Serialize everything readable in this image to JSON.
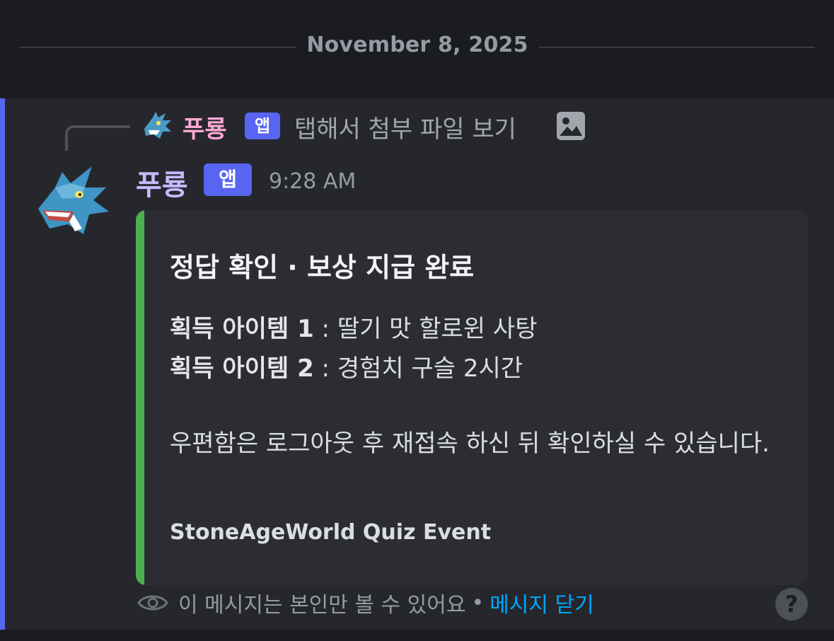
{
  "date_divider": {
    "label": "November 8, 2025"
  },
  "reply_preview": {
    "author": "푸룡",
    "tag": "앱",
    "text": "탭해서 첨부 파일 보기",
    "attachment_icon": "image-icon",
    "author_color": "#f9a8d4"
  },
  "message": {
    "author": "푸룡",
    "tag": "앱",
    "timestamp": "9:28 AM",
    "author_color": "#c9b8ff",
    "mention_highlight_color": "#5865f2"
  },
  "embed": {
    "accent_color": "#4caf50",
    "title": "정답 확인 · 보상 지급 완료",
    "items": [
      {
        "label": "획득 아이템 1",
        "separator": " : ",
        "value": "딸기 맛 할로윈 사탕"
      },
      {
        "label": "획득 아이템 2",
        "separator": " : ",
        "value": "경험치 구슬 2시간"
      }
    ],
    "notice": "우편함은 로그아웃 후 재접속 하신 뒤 확인하실 수 있습니다.",
    "footer": "StoneAgeWorld Quiz Event"
  },
  "ephemeral": {
    "icon": "eye-icon",
    "text": "이 메시지는 본인만 볼 수 있어요",
    "separator": "•",
    "dismiss_label": "메시지 닫기",
    "dismiss_color": "#00a8fc"
  },
  "help": {
    "icon": "help-icon",
    "label": "?"
  }
}
